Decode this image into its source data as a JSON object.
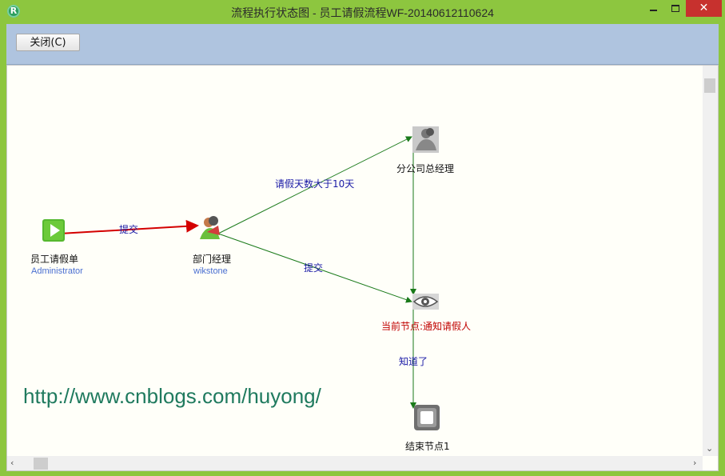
{
  "window": {
    "title": "流程执行状态图 - 员工请假流程WF-20140612110624",
    "app_icon": "R",
    "min_label": "",
    "max_label": "",
    "close_label": "✕"
  },
  "toolbar": {
    "close_button": "关闭(C)"
  },
  "diagram": {
    "nodes": {
      "start": {
        "label": "员工请假单",
        "sub": "Administrator",
        "icon": "play-icon"
      },
      "dept_manager": {
        "label": "部门经理",
        "sub": "wikstone",
        "icon": "user-icon"
      },
      "branch_manager": {
        "label": "分公司总经理",
        "icon": "user-icon"
      },
      "notify": {
        "label": "当前节点:通知请假人",
        "icon": "eye-icon",
        "status": "current"
      },
      "end": {
        "label": "结束节点1",
        "icon": "stop-icon"
      }
    },
    "edges": {
      "start_to_dept": {
        "label": "提交",
        "color": "#d40000"
      },
      "dept_to_branch": {
        "label": "请假天数大于10天",
        "color": "#1a7a1a"
      },
      "dept_to_notify": {
        "label": "提交",
        "color": "#1a7a1a"
      },
      "notify_to_end": {
        "label": "知道了",
        "color": "#1a7a1a"
      }
    }
  },
  "watermark": "http://www.cnblogs.com/huyong/"
}
